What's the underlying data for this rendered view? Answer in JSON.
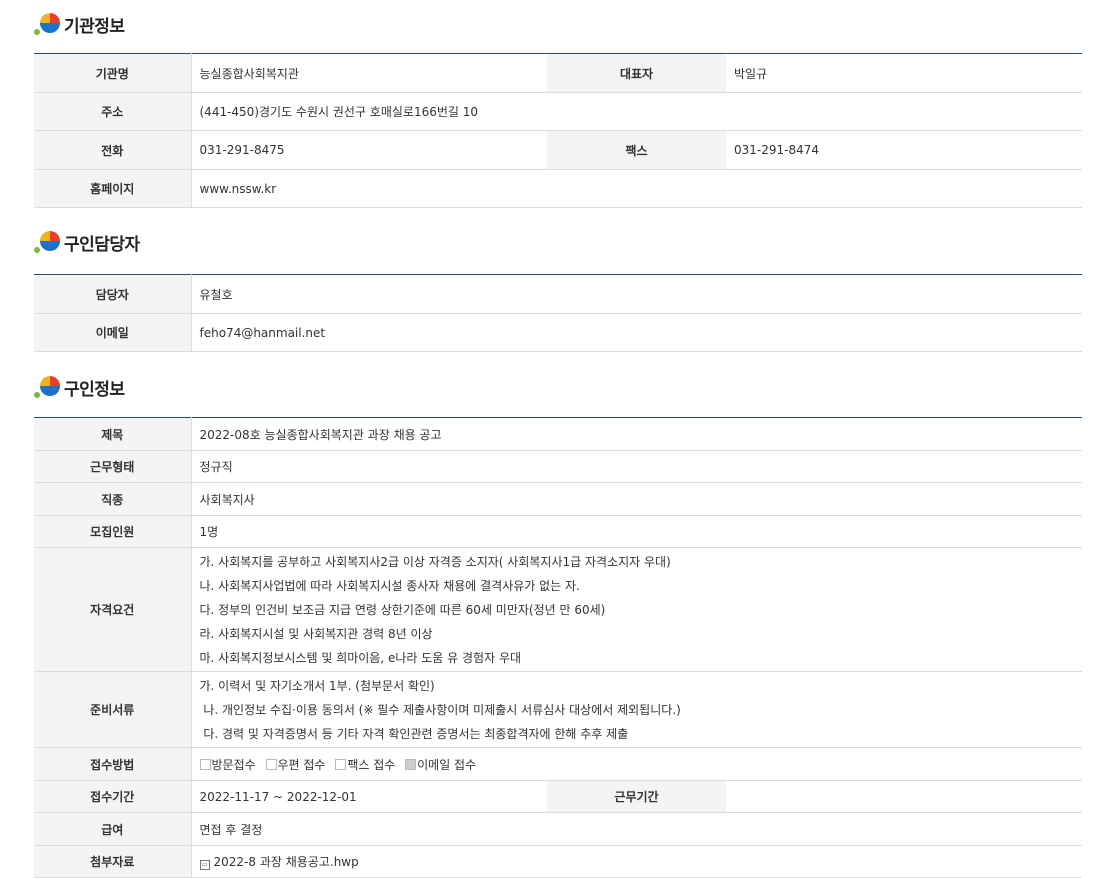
{
  "sections": {
    "org": "기관정보",
    "contact": "구인담당자",
    "job": "구인정보"
  },
  "org": {
    "name_label": "기관명",
    "name": "능실종합사회복지관",
    "rep_label": "대표자",
    "rep": "박일규",
    "addr_label": "주소",
    "addr": "(441-450)경기도 수원시 권선구 호매실로166번길 10",
    "tel_label": "전화",
    "tel": "031-291-8475",
    "fax_label": "팩스",
    "fax": "031-291-8474",
    "home_label": "홈페이지",
    "home": "www.nssw.kr"
  },
  "contact": {
    "person_label": "담당자",
    "person": "유철호",
    "email_label": "이메일",
    "email": "feho74@hanmail.net"
  },
  "job": {
    "title_label": "제목",
    "title": "2022-08호 능실종합사회복지관 과장 채용 공고",
    "type_label": "근무형태",
    "type": "정규직",
    "kind_label": "직종",
    "kind": "사회복지사",
    "count_label": "모집인원",
    "count": "1명",
    "req_label": "자격요건",
    "req": [
      "가. 사회복지를 공부하고 사회복지사2급 이상 자격증 소지자( 사회복지사1급 자격소지자 우대)",
      "나. 사회복지사업법에 따라 사회복지시설 종사자 채용에 결격사유가 없는 자.",
      "다. 정부의 인건비 보조금 지급 연령 상한기준에 따른 60세 미만자(정년 만 60세)",
      "라. 사회복지시설 및 사회복지관 경력 8년 이상",
      "마. 사회복지정보시스템 및 희마이음, e나라 도움 유 경험자 우대"
    ],
    "docs_label": "준비서류",
    "docs": [
      "가. 이력서 및 자기소개서 1부. (첨부문서 확인)",
      " 나. 개인정보 수집·이용 동의서 (※ 필수 제출사항이며 미제출시 서류심사 대상에서 제외됩니다.)",
      " 다. 경력 및 자격증명서 등 기타 자격 확인관련 증명서는 최종합격자에 한해 추후 제출"
    ],
    "method_label": "접수방법",
    "methods": [
      {
        "label": "방문접수",
        "checked": false
      },
      {
        "label": "우편 접수",
        "checked": false
      },
      {
        "label": "팩스 접수",
        "checked": false
      },
      {
        "label": "이메일 접수",
        "checked": true
      }
    ],
    "period_label": "접수기간",
    "period": "2022-11-17 ~ 2022-12-01",
    "workperiod_label": "근무기간",
    "workperiod": "",
    "pay_label": "급여",
    "pay": "면접 후 결정",
    "file_label": "첨부자료",
    "file": "2022-8 과장 채용공고.hwp"
  }
}
